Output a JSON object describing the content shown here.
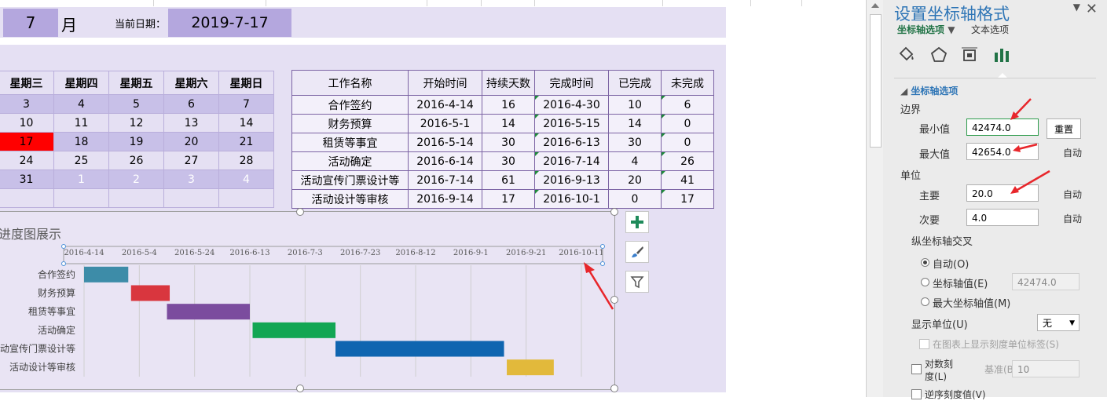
{
  "header": {
    "month": "7",
    "month_unit": "月",
    "date_label": "当前日期：",
    "date_value": "2019-7-17"
  },
  "calendar": {
    "weekdays": [
      "星期三",
      "星期四",
      "星期五",
      "星期六",
      "星期日"
    ],
    "rows": [
      [
        "3",
        "4",
        "5",
        "6",
        "7"
      ],
      [
        "10",
        "11",
        "12",
        "13",
        "14"
      ],
      [
        "17",
        "18",
        "19",
        "20",
        "21"
      ],
      [
        "24",
        "25",
        "26",
        "27",
        "28"
      ],
      [
        "31",
        "1",
        "2",
        "3",
        "4"
      ],
      [
        "",
        "",
        "",
        "",
        ""
      ]
    ],
    "highlight_color": "#ff0000"
  },
  "tasks": {
    "headers": [
      "工作名称",
      "开始时间",
      "持续天数",
      "完成时间",
      "已完成",
      "未完成"
    ],
    "rows": [
      [
        "合作签约",
        "2016-4-14",
        "16",
        "2016-4-30",
        "10",
        "6"
      ],
      [
        "财务预算",
        "2016-5-1",
        "14",
        "2016-5-15",
        "14",
        "0"
      ],
      [
        "租赁等事宜",
        "2016-5-14",
        "30",
        "2016-6-13",
        "30",
        "0"
      ],
      [
        "活动确定",
        "2016-6-14",
        "30",
        "2016-7-14",
        "4",
        "26"
      ],
      [
        "活动宣传门票设计等",
        "2016-7-14",
        "61",
        "2016-9-13",
        "20",
        "41"
      ],
      [
        "活动设计等审核",
        "2016-9-14",
        "17",
        "2016-10-1",
        "0",
        "17"
      ]
    ]
  },
  "chart_data": {
    "type": "bar",
    "title": "进度图展示",
    "x_ticks": [
      "2016-4-14",
      "2016-5-4",
      "2016-5-24",
      "2016-6-13",
      "2016-7-3",
      "2016-7-23",
      "2016-8-12",
      "2016-9-1",
      "2016-9-21",
      "2016-10-11"
    ],
    "xlim_serial": [
      42474,
      42654
    ],
    "major_unit": 20,
    "categories": [
      "合作签约",
      "财务预算",
      "租赁等事宜",
      "活动确定",
      "活动宣传门票设计等",
      "活动设计等审核"
    ],
    "bars": [
      {
        "start": 42474,
        "duration": 16,
        "color": "#3d8ca8"
      },
      {
        "start": 42491,
        "duration": 14,
        "color": "#d9363e"
      },
      {
        "start": 42504,
        "duration": 30,
        "color": "#7b4c9e"
      },
      {
        "start": 42535,
        "duration": 30,
        "color": "#12a653"
      },
      {
        "start": 42565,
        "duration": 61,
        "color": "#0f65b0"
      },
      {
        "start": 42627,
        "duration": 17,
        "color": "#e2b93b"
      }
    ],
    "grid": true
  },
  "panel": {
    "title": "设置坐标轴格式",
    "tab_axis": "坐标轴选项",
    "tab_text": "文本选项",
    "section": "坐标轴选项",
    "bounds_label": "边界",
    "min_label": "最小值",
    "min_value": "42474.0",
    "reset_label": "重置",
    "max_label": "最大值",
    "max_value": "42654.0",
    "auto_label": "自动",
    "units_label": "单位",
    "major_label": "主要",
    "major_value": "20.0",
    "minor_label": "次要",
    "minor_value": "4.0",
    "cross_label": "纵坐标轴交叉",
    "radio_auto": "自动(O)",
    "radio_axis_value": "坐标轴值(E)",
    "axis_value": "42474.0",
    "radio_max": "最大坐标轴值(M)",
    "display_units_label": "显示单位(U)",
    "display_units_value": "无",
    "show_units_label": "在图表上显示刻度单位标签(S)",
    "log_label_1": "对数刻",
    "log_label_2": "度(L)",
    "base_label": "基准(B)",
    "base_value": "10",
    "reverse_label": "逆序刻度值(V)"
  },
  "colors": {
    "accent_blue": "#2e75b6",
    "accent_green": "#217346",
    "arrow_red": "#e8262b"
  }
}
